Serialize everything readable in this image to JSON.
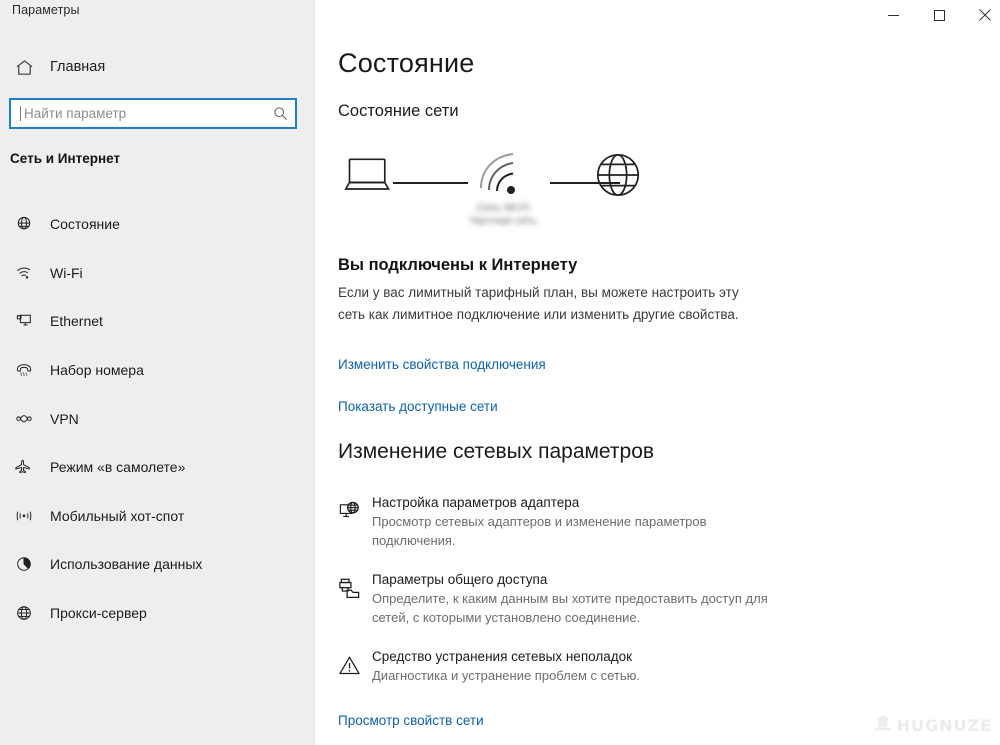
{
  "window": {
    "title": "Параметры",
    "controls": [
      {
        "name": "minimize",
        "glyph": "minimize-icon"
      },
      {
        "name": "maximize",
        "glyph": "maximize-icon"
      },
      {
        "name": "close",
        "glyph": "close-icon"
      }
    ]
  },
  "sidebar": {
    "home": {
      "label": "Главная",
      "icon": "home-icon"
    },
    "search": {
      "value": "",
      "placeholder": "Найти параметр",
      "icon": "search-icon",
      "focused": true
    },
    "category": "Сеть и Интернет",
    "items": [
      {
        "label": "Состояние",
        "icon": "network-status-icon",
        "selected": true
      },
      {
        "label": "Wi-Fi",
        "icon": "wifi-icon",
        "selected": false
      },
      {
        "label": "Ethernet",
        "icon": "ethernet-icon",
        "selected": false
      },
      {
        "label": "Набор номера",
        "icon": "dialup-phone-icon",
        "selected": false
      },
      {
        "label": "VPN",
        "icon": "vpn-icon",
        "selected": false
      },
      {
        "label": "Режим «в самолете»",
        "icon": "airplane-icon",
        "selected": false
      },
      {
        "label": "Мобильный хот-спот",
        "icon": "hotspot-icon",
        "selected": false
      },
      {
        "label": "Использование данных",
        "icon": "data-usage-pie-icon",
        "selected": false
      },
      {
        "label": "Прокси-сервер",
        "icon": "globe-icon",
        "selected": false
      }
    ]
  },
  "main": {
    "page_title": "Состояние",
    "section_subtitle": "Состояние сети",
    "diagram": {
      "device_icon": "laptop-icon",
      "connection_icon": "wifi-signal-icon",
      "internet_icon": "globe-icon",
      "blurred_label_line1": "Сеть Wi-Fi",
      "blurred_label_line2": "Частная сеть"
    },
    "status": {
      "heading": "Вы подключены к Интернету",
      "description": "Если у вас лимитный тарифный план, вы можете настроить эту сеть как лимитное подключение или изменить другие свойства."
    },
    "links": {
      "change_properties": "Изменить свойства подключения",
      "show_networks": "Показать доступные сети",
      "view_network_properties": "Просмотр свойств сети"
    },
    "settings_heading": "Изменение сетевых параметров",
    "settings_items": [
      {
        "icon": "adapter-options-icon",
        "title": "Настройка параметров адаптера",
        "description": "Просмотр сетевых адаптеров и изменение параметров подключения."
      },
      {
        "icon": "sharing-options-icon",
        "title": "Параметры общего доступа",
        "description": "Определите, к каким данным вы хотите предоставить доступ для сетей, с которыми установлено соединение."
      },
      {
        "icon": "troubleshooter-warning-icon",
        "title": "Средство устранения сетевых неполадок",
        "description": "Диагностика и устранение проблем с сетью."
      }
    ]
  },
  "watermark": {
    "text": "HUGNUZE"
  },
  "colors": {
    "accent": "#0a62b0",
    "search_focus_border": "#1f7fc4",
    "sidebar_bg": "#eeeeee",
    "content_bg": "#ffffff",
    "muted_text": "#6d6d6d"
  }
}
